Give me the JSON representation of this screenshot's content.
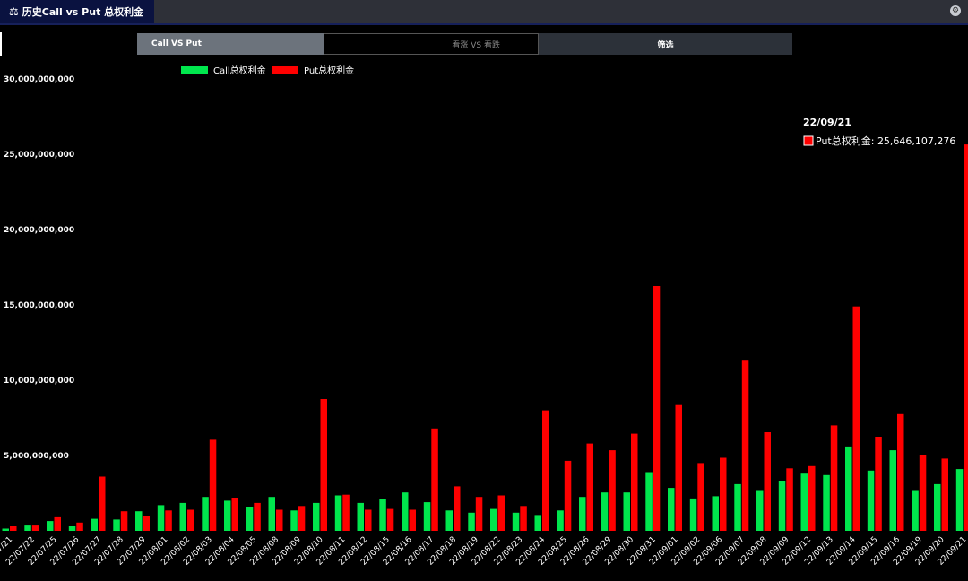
{
  "header": {
    "title": "历史Call vs Put 总权利金",
    "title_icon": "chart-icon",
    "settings_icon": "gear-icon"
  },
  "tabs": {
    "call_vs_put": "Call VS Put",
    "up_vs_down": "看涨 VS 看跌",
    "filter": "筛选"
  },
  "tooltip": {
    "date": "22/09/21",
    "label": "Put总权利金",
    "value": "25,646,107,276"
  },
  "colors": {
    "call": "#00e64d",
    "put": "#ff0000",
    "background": "#000000"
  },
  "chart_data": {
    "type": "bar",
    "ylim": [
      0,
      30000000000
    ],
    "yticks": [
      "5,000,000,000",
      "10,000,000,000",
      "15,000,000,000",
      "20,000,000,000",
      "25,000,000,000",
      "30,000,000,000"
    ],
    "legend_placement": "top-left",
    "grid": false,
    "categories": [
      "22/07/21",
      "22/07/22",
      "22/07/25",
      "22/07/26",
      "22/07/27",
      "22/07/28",
      "22/07/29",
      "22/08/01",
      "22/08/02",
      "22/08/03",
      "22/08/04",
      "22/08/05",
      "22/08/08",
      "22/08/09",
      "22/08/10",
      "22/08/11",
      "22/08/12",
      "22/08/15",
      "22/08/16",
      "22/08/17",
      "22/08/18",
      "22/08/19",
      "22/08/22",
      "22/08/23",
      "22/08/24",
      "22/08/25",
      "22/08/26",
      "22/08/29",
      "22/08/30",
      "22/08/31",
      "22/09/01",
      "22/09/02",
      "22/09/06",
      "22/09/07",
      "22/09/08",
      "22/09/09",
      "22/09/12",
      "22/09/13",
      "22/09/14",
      "22/09/15",
      "22/09/16",
      "22/09/19",
      "22/09/20",
      "22/09/21"
    ],
    "series": [
      {
        "name": "Call总权利金",
        "values": [
          150000000,
          350000000,
          650000000,
          300000000,
          800000000,
          750000000,
          1300000000,
          1700000000,
          1850000000,
          2250000000,
          2000000000,
          1600000000,
          2250000000,
          1350000000,
          1850000000,
          2350000000,
          1850000000,
          2100000000,
          2550000000,
          1900000000,
          1350000000,
          1200000000,
          1450000000,
          1200000000,
          1050000000,
          1350000000,
          2250000000,
          2550000000,
          2550000000,
          3900000000,
          2850000000,
          2150000000,
          2300000000,
          3100000000,
          2650000000,
          3300000000,
          3800000000,
          3700000000,
          5600000000,
          4000000000,
          5350000000,
          2650000000,
          3100000000,
          4100000000
        ]
      },
      {
        "name": "Put总权利金",
        "values": [
          300000000,
          350000000,
          900000000,
          550000000,
          3600000000,
          1300000000,
          1000000000,
          1350000000,
          1400000000,
          6050000000,
          2200000000,
          1850000000,
          1400000000,
          1650000000,
          8750000000,
          2400000000,
          1400000000,
          1450000000,
          1400000000,
          6800000000,
          2950000000,
          2250000000,
          2350000000,
          1650000000,
          8000000000,
          4650000000,
          5800000000,
          5350000000,
          6450000000,
          16250000000,
          8350000000,
          4500000000,
          4850000000,
          11300000000,
          6550000000,
          4150000000,
          4300000000,
          7000000000,
          14900000000,
          6250000000,
          7750000000,
          5050000000,
          4800000000,
          25646107276
        ]
      }
    ]
  }
}
